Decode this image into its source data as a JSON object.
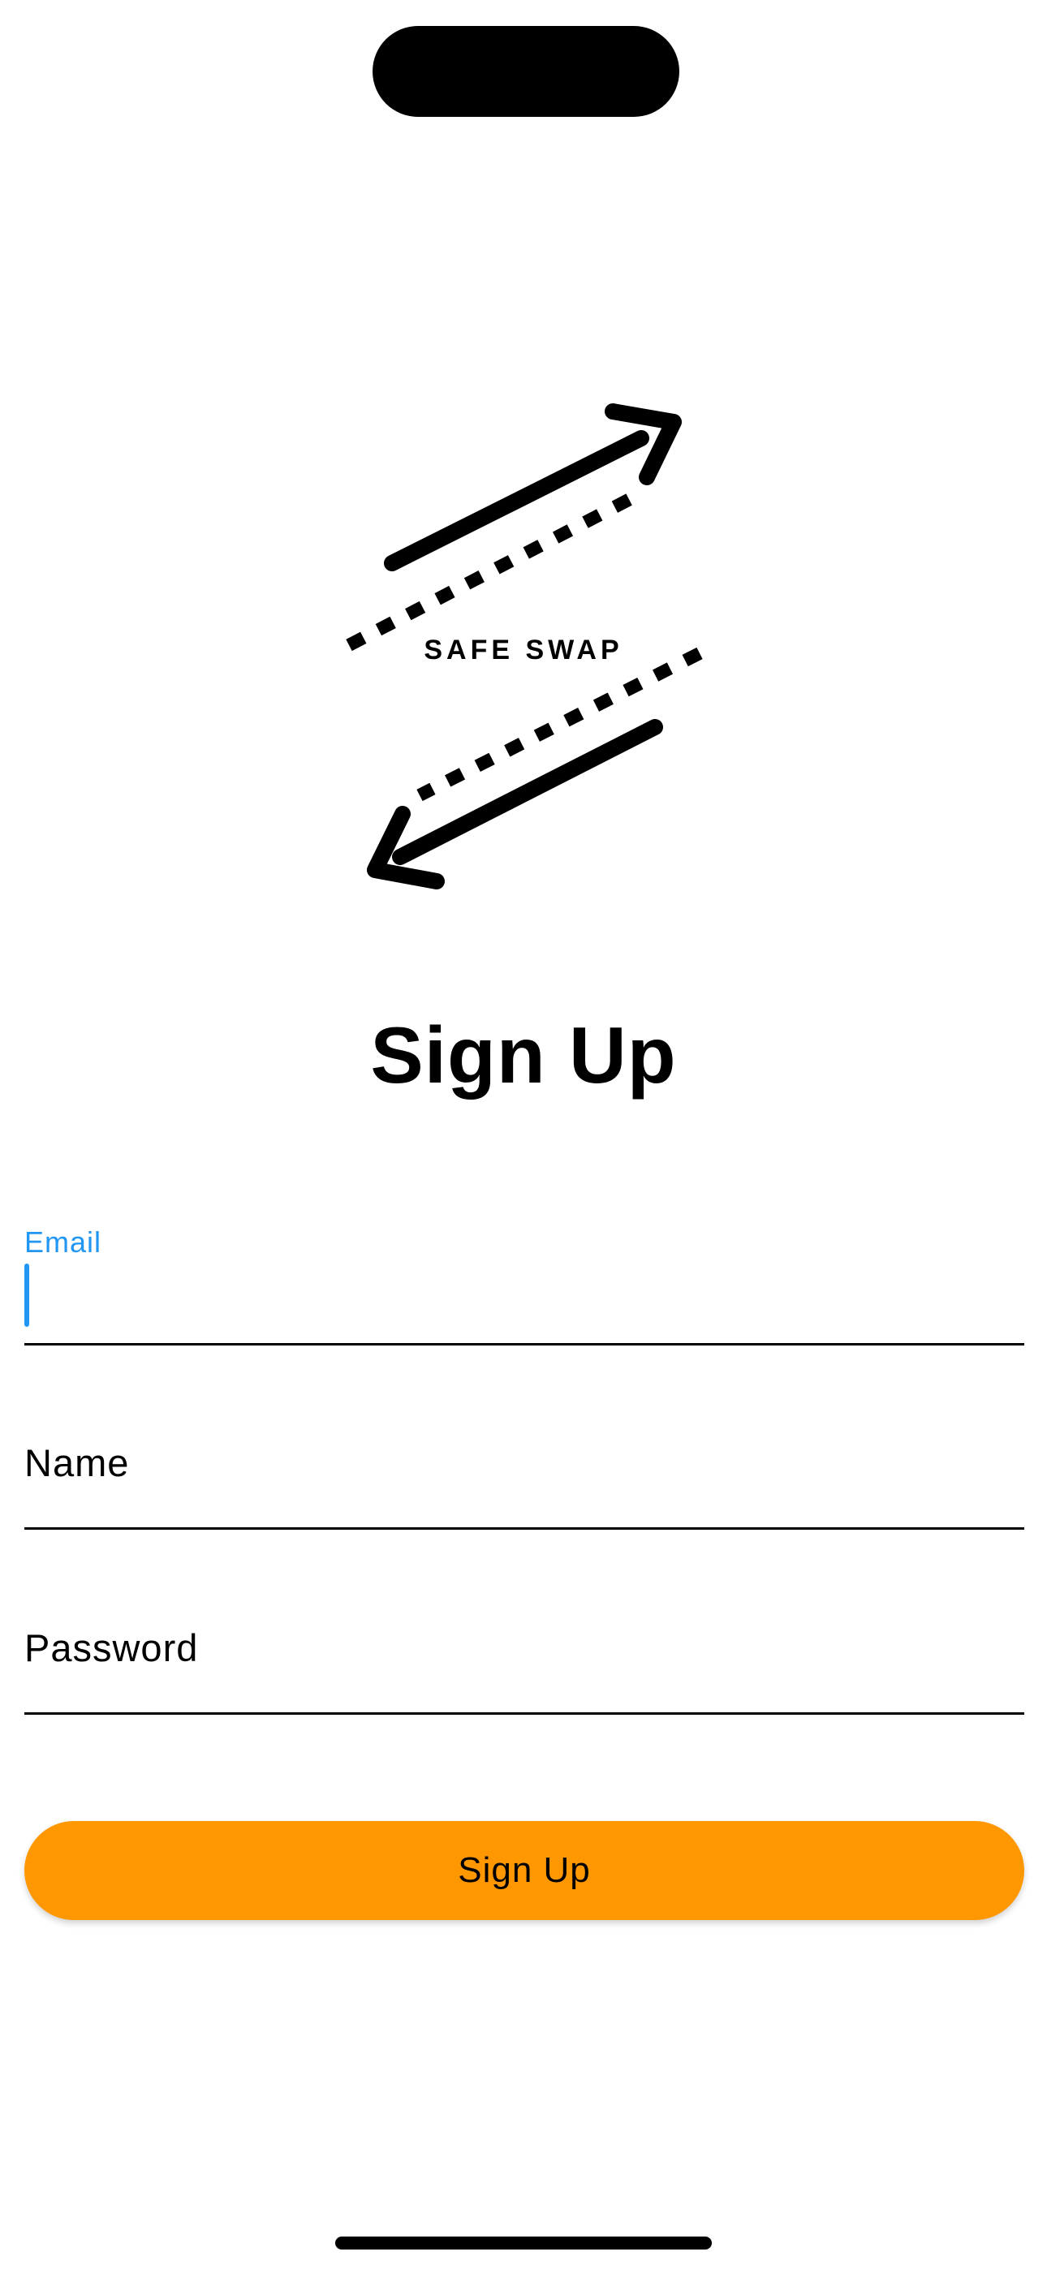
{
  "logo": {
    "text": "SAFE SWAP",
    "icon": "two-way-arrows-logo"
  },
  "page": {
    "title": "Sign Up"
  },
  "form": {
    "email": {
      "label": "Email",
      "value": ""
    },
    "name": {
      "label": "Name",
      "value": ""
    },
    "password": {
      "label": "Password",
      "value": ""
    },
    "submit_label": "Sign Up"
  },
  "colors": {
    "accent": "#2196F3",
    "button": "#FF9800"
  }
}
